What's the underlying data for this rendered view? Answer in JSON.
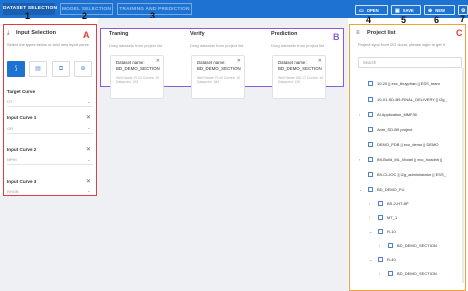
{
  "topbar": {
    "tabs": [
      {
        "label": "DATASET SELECTION",
        "number": "1"
      },
      {
        "label": "MODEL SELECTION",
        "number": "2"
      },
      {
        "label": "TRAINING AND PREDICTION",
        "number": "3"
      }
    ],
    "buttons": [
      {
        "label": "OPEN",
        "icon": "folder-open-icon",
        "number": "4"
      },
      {
        "label": "SAVE",
        "icon": "save-icon",
        "number": "5"
      },
      {
        "label": "NEW",
        "icon": "plus-circle-icon",
        "number": "6"
      }
    ],
    "settings_number": "7",
    "bar_color": "#1e73d2"
  },
  "input_selection": {
    "title": "Input Selection",
    "marker": "A",
    "subtitle": "Select the types below or Add new input curve",
    "target_curve": {
      "label": "Target Curve",
      "value": "DT"
    },
    "input_curves": [
      {
        "label": "Input Curve 1",
        "value": "GR"
      },
      {
        "label": "Input Curve 2",
        "value": "NPHI"
      },
      {
        "label": "Input Curve 3",
        "value": "RHOB"
      }
    ],
    "border_color": "#e23b3b"
  },
  "datasets": {
    "marker": "B",
    "border_color": "#8a5ad8",
    "columns": [
      {
        "title": "Traning",
        "subtitle": "Drag datasets from project list",
        "card": {
          "title": "Dataset name: BD_DEMO_SECTION",
          "meta": "Well Name: R-10   Curves: 10   Datapoint: 153"
        }
      },
      {
        "title": "Verify",
        "subtitle": "Drag datasets from project list",
        "card": {
          "title": "Dataset name: BD_DEMO_SECTION",
          "meta": "Well Name: R-40   Curves: 10   Datapoint: 184"
        }
      },
      {
        "title": "Prediction",
        "subtitle": "Drag datasets from project list",
        "card": {
          "title": "Dataset name: BD_DEMO_SECTION",
          "meta": "Well Name: BS-1T   Curves: 10   Datapoint: 126"
        }
      }
    ]
  },
  "project_list": {
    "title": "Project list",
    "marker": "C",
    "subtitle": "Project sync from i2G cloud, please login to get it",
    "search_placeholder": "Search",
    "border_color": "#f0a33c",
    "items": [
      {
        "label": "10-20 || ecc_thuyphan || ESS_team"
      },
      {
        "label": "10-01-SD-B9-FINAL_DELIVERY || i2g_"
      },
      {
        "label": "AI Application_MMF30"
      },
      {
        "label": "Anm_SD-B9 project"
      },
      {
        "label": "DEMO_PDB || ecc_demo || DEMO"
      },
      {
        "label": "B9-Build_ML_Model || ecc_hoadnh ||"
      },
      {
        "label": "B9-CLJOC || i2g_administrator || ESS_"
      },
      {
        "label": "BD_DEMO_FU"
      },
      {
        "label": "BS-2-HT-8P"
      },
      {
        "label": "MT_1"
      },
      {
        "label": "R-10"
      },
      {
        "label": "BD_DEMO_SECTION"
      },
      {
        "label": "R-40"
      },
      {
        "label": "BD_DEMO_SECTION"
      }
    ]
  }
}
